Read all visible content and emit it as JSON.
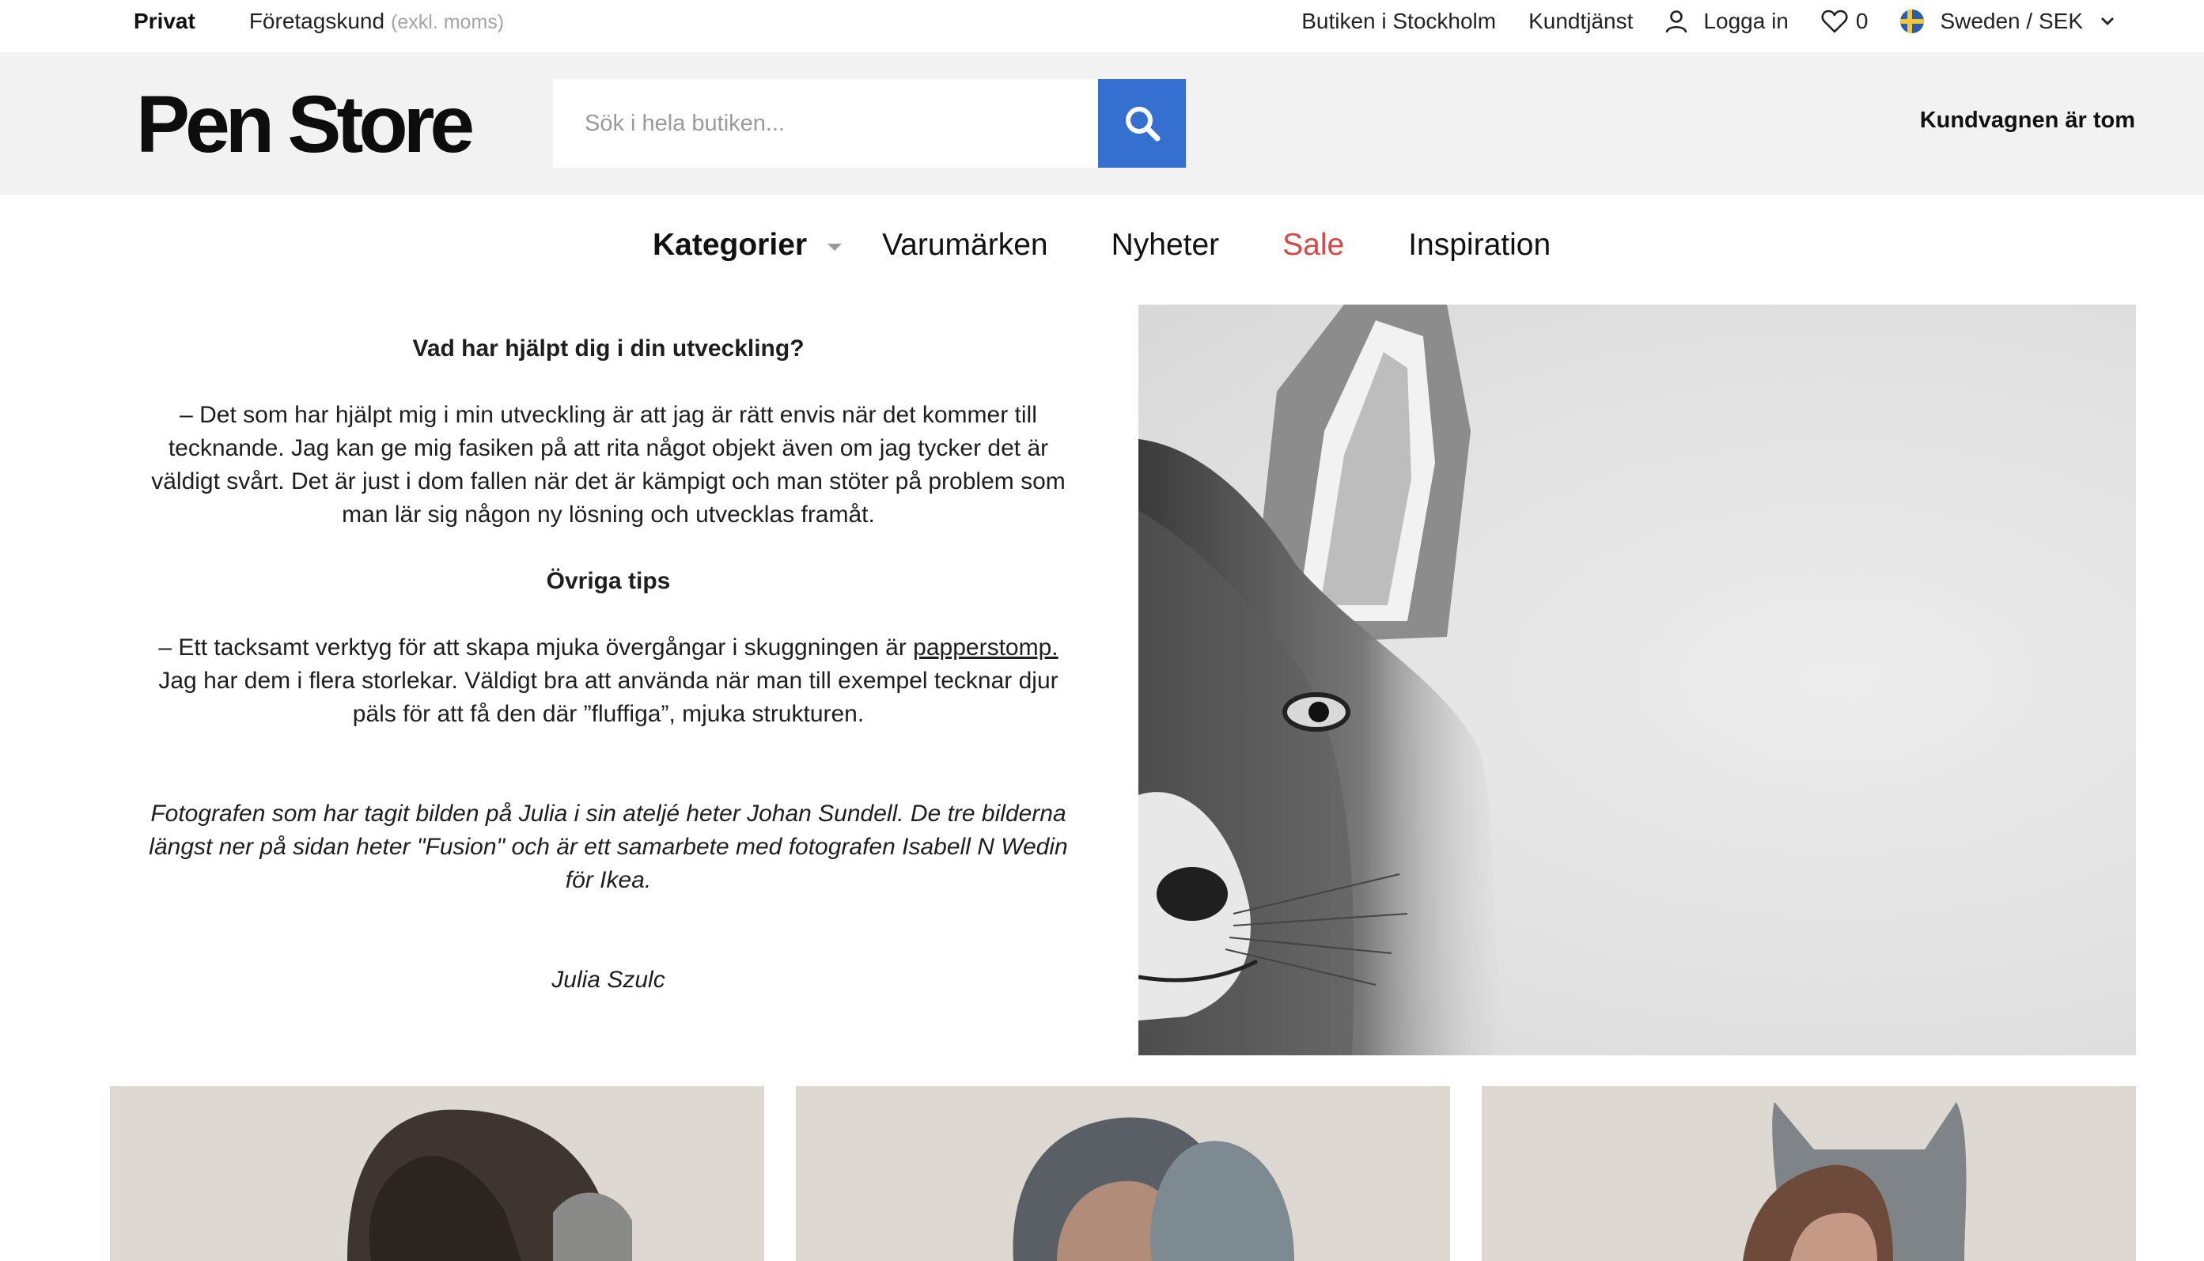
{
  "topbar": {
    "privat": "Privat",
    "foretagskund": "Företagskund",
    "exkl_moms": "(exkl. moms)",
    "butiken": "Butiken i Stockholm",
    "kundtjanst": "Kundtjänst",
    "logga_in": "Logga in",
    "wishlist_count": "0",
    "region": "Sweden / SEK"
  },
  "header": {
    "logo": "Pen Store",
    "search_placeholder": "Sök i hela butiken...",
    "cart": "Kundvagnen är tom"
  },
  "nav": {
    "items": [
      "Kategorier",
      "Varumärken",
      "Nyheter",
      "Sale",
      "Inspiration"
    ]
  },
  "article": {
    "q1": "Vad har hjälpt dig i din utveckling?",
    "a1": "– Det som har hjälpt mig i min utveckling är att jag är rätt envis när det kommer till tecknande. Jag kan ge mig fasiken på att rita något objekt även om jag tycker det är väldigt svårt. Det är just i dom fallen när det är kämpigt och man stöter på problem som man lär sig någon ny lösning och utvecklas framåt.",
    "q2": "Övriga tips",
    "a2_prefix": "– Ett tacksamt verktyg för att skapa mjuka övergångar i skuggningen är",
    "a2_link": "papperstomp.",
    "a2_suffix": "Jag har dem i flera storlekar. Väldigt bra att använda när man till exempel tecknar djur päls för att få den där ”fluffiga”, mjuka strukturen.",
    "caption": "Fotografen som har tagit bilden på Julia i sin ateljé heter Johan Sundell. De tre bilderna längst ner på sidan heter \"Fusion\" och är ett samarbete med fotografen Isabell N Wedin för Ikea.",
    "author": "Julia Szulc"
  },
  "icons": {
    "user": "user-icon",
    "heart": "heart-icon",
    "flag": "sweden-flag-icon",
    "chevron": "chevron-down-icon",
    "search": "search-icon"
  },
  "colors": {
    "accent": "#3570d1",
    "sale": "#d64848",
    "header_bg": "#f2f2f2"
  }
}
